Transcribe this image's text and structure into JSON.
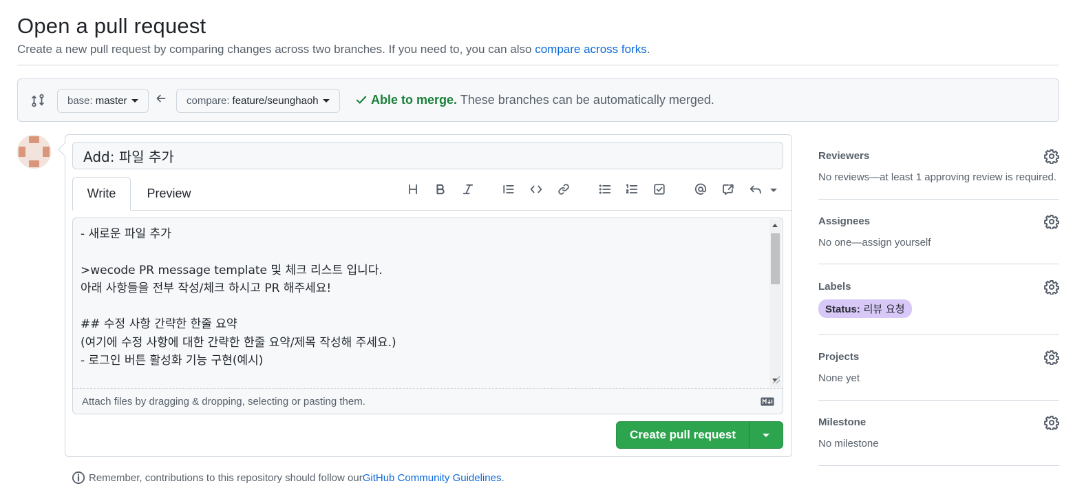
{
  "page": {
    "title": "Open a pull request",
    "subtitle_prefix": "Create a new pull request by comparing changes across two branches. If you need to, you can also ",
    "subtitle_link": "compare across forks",
    "subtitle_suffix": "."
  },
  "compare": {
    "base_prefix": "base:",
    "base_branch": "master",
    "compare_prefix": "compare:",
    "compare_branch": "feature/seunghaoh",
    "merge_status": "Able to merge.",
    "merge_detail": " These branches can be automatically merged.",
    "status_color": "#1a7f37"
  },
  "form": {
    "title_value": "Add: 파일 추가",
    "tabs": [
      {
        "label": "Write",
        "active": true
      },
      {
        "label": "Preview",
        "active": false
      }
    ],
    "toolbar_icons": [
      "heading-icon",
      "bold-icon",
      "italic-icon",
      "quote-icon",
      "code-icon",
      "link-icon",
      "bullet-list-icon",
      "numbered-list-icon",
      "task-list-icon",
      "mention-icon",
      "reference-icon",
      "undo-icon"
    ],
    "body_lines": [
      "- 새로운 파일 추가",
      "",
      ">wecode PR message template 및 체크 리스트 입니다.",
      "아래 사항들을 전부 작성/체크 하시고 PR 해주세요!",
      "",
      "## 수정 사항 간략한 한줄 요약",
      "(여기에 수정 사항에 대한 간략한 한줄 요약/제목 작성해 주세요.)",
      "- 로그인 버튼 활성화 기능 구현(예시)"
    ],
    "attach_text": "Attach files by dragging & dropping, selecting or pasting them.",
    "submit_label": "Create pull request",
    "submit_color": "#2da44e"
  },
  "note": {
    "prefix": "Remember, contributions to this repository should follow our ",
    "link": "GitHub Community Guidelines",
    "suffix": "."
  },
  "sidebar": {
    "reviewers": {
      "label": "Reviewers",
      "value": "No reviews—at least 1 approving review is required."
    },
    "assignees": {
      "label": "Assignees",
      "value": "No one—assign yourself"
    },
    "labels": {
      "label": "Labels",
      "pill_key": "Status:",
      "pill_value": " 리뷰 요청",
      "pill_color": "#d8c8f8"
    },
    "projects": {
      "label": "Projects",
      "value": "None yet"
    },
    "milestone": {
      "label": "Milestone",
      "value": "No milestone"
    }
  }
}
